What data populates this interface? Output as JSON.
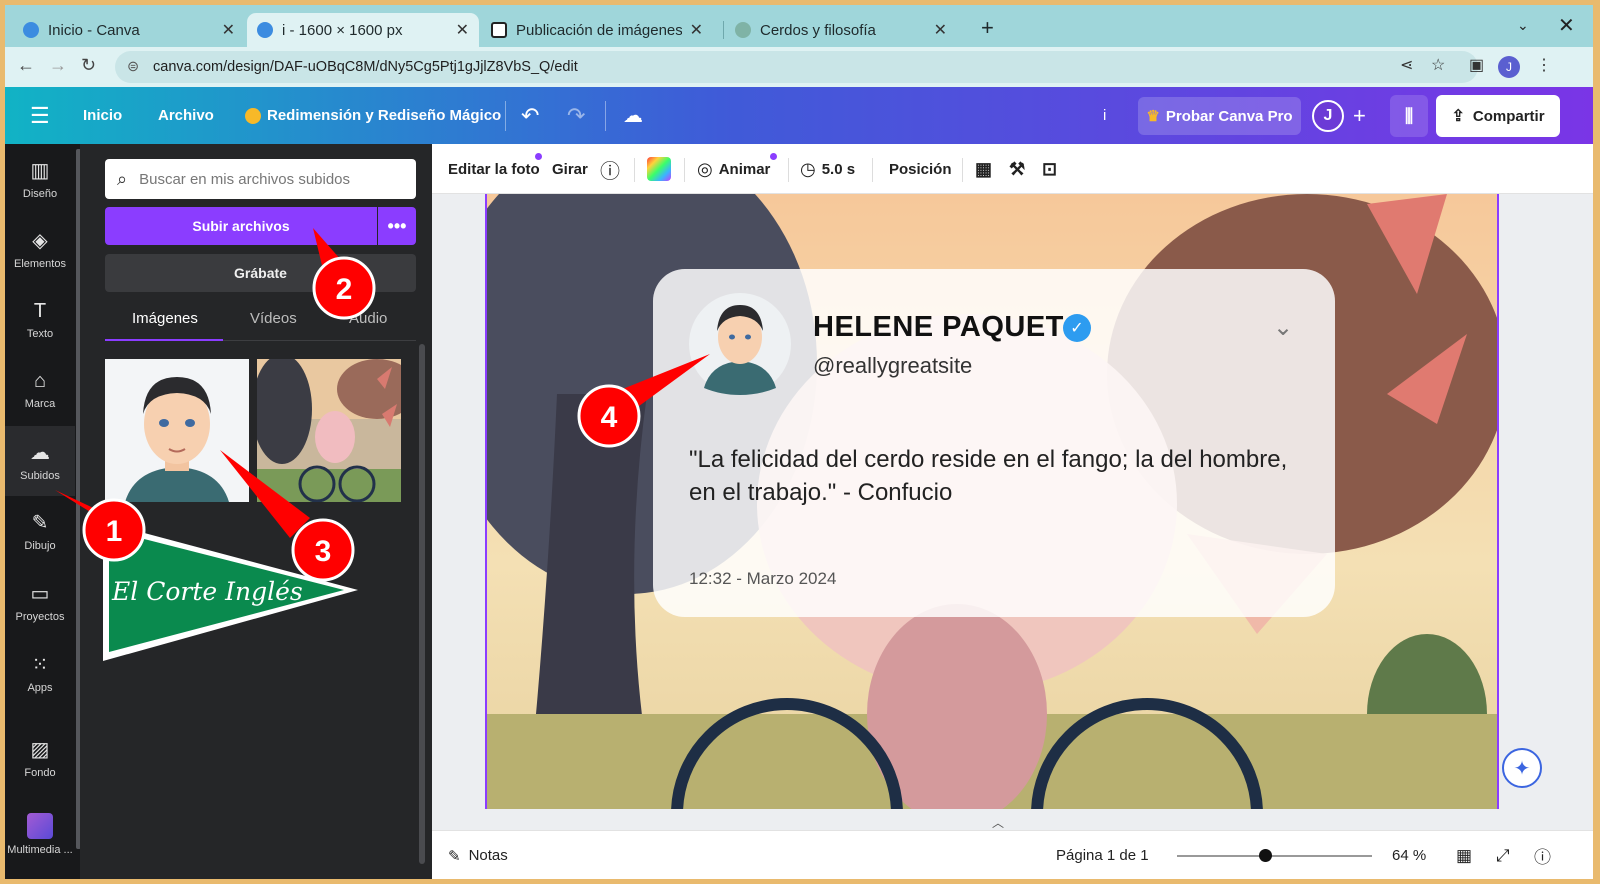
{
  "browser": {
    "tabs": [
      {
        "title": "Inicio - Canva",
        "active": false,
        "icon": "canva-icon"
      },
      {
        "title": "i - 1600 × 1600 px",
        "active": true,
        "icon": "canva-icon"
      },
      {
        "title": "Publicación de imágenes",
        "active": false,
        "icon": "notion-icon"
      },
      {
        "title": "Cerdos y filosofía",
        "active": false,
        "icon": "chatgpt-icon"
      }
    ],
    "new_tab": "+",
    "url": "canva.com/design/DAF-uOBqC8M/dNy5Cg5Ptj1gJjlZ8VbS_Q/edit",
    "profile_initial": "J"
  },
  "header": {
    "home": "Inicio",
    "file": "Archivo",
    "magic_resize": "Redimensión y Rediseño Mágico",
    "title_short": "i",
    "try_pro": "Probar Canva Pro",
    "avatar": "J",
    "share": "Compartir"
  },
  "rail": [
    {
      "label": "Diseño",
      "icon": "layout-icon"
    },
    {
      "label": "Elementos",
      "icon": "shapes-icon"
    },
    {
      "label": "Texto",
      "icon": "text-icon"
    },
    {
      "label": "Marca",
      "icon": "brand-icon"
    },
    {
      "label": "Subidos",
      "icon": "cloud-upload-icon"
    },
    {
      "label": "Dibujo",
      "icon": "pen-icon"
    },
    {
      "label": "Proyectos",
      "icon": "folder-icon"
    },
    {
      "label": "Apps",
      "icon": "apps-icon"
    },
    {
      "label": "Fondo",
      "icon": "background-icon"
    },
    {
      "label": "Multimedia ...",
      "icon": "multimedia-icon"
    }
  ],
  "panel": {
    "search_placeholder": "Buscar en mis archivos subidos",
    "upload": "Subir archivos",
    "record": "Grábate",
    "tabs": [
      "Imágenes",
      "Vídeos",
      "Audio"
    ],
    "logo_text": "El Corte Inglés"
  },
  "toolbar": {
    "edit_photo": "Editar la foto",
    "rotate": "Girar",
    "animate": "Animar",
    "duration": "5.0 s",
    "position": "Posición"
  },
  "card": {
    "name": "HELENE PAQUET",
    "handle": "@reallygreatsite",
    "quote": "\"La felicidad del cerdo reside en el fango; la del hombre, en el trabajo.\" - Confucio",
    "date": "12:32 - Marzo 2024"
  },
  "bottom": {
    "notes": "Notas",
    "page": "Página 1 de 1",
    "zoom": "64 %",
    "zoom_level": 0.45
  },
  "annotations": [
    "1",
    "2",
    "3",
    "4"
  ],
  "colors": {
    "accent": "#8b3dff",
    "annotation": "#ff0000",
    "logo_green": "#0a8a4e"
  }
}
